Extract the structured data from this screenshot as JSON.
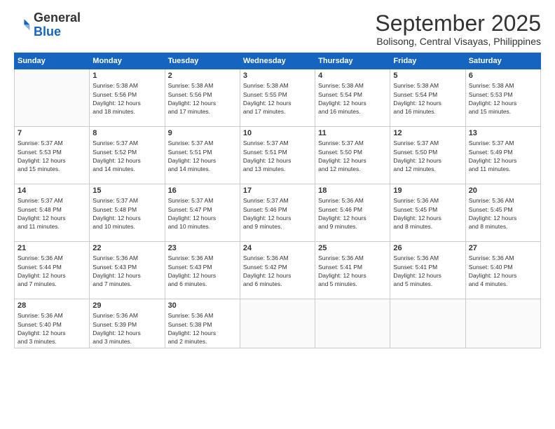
{
  "header": {
    "logo_general": "General",
    "logo_blue": "Blue",
    "month_title": "September 2025",
    "location": "Bolisong, Central Visayas, Philippines"
  },
  "weekdays": [
    "Sunday",
    "Monday",
    "Tuesday",
    "Wednesday",
    "Thursday",
    "Friday",
    "Saturday"
  ],
  "weeks": [
    [
      {
        "day": "",
        "info": ""
      },
      {
        "day": "1",
        "info": "Sunrise: 5:38 AM\nSunset: 5:56 PM\nDaylight: 12 hours\nand 18 minutes."
      },
      {
        "day": "2",
        "info": "Sunrise: 5:38 AM\nSunset: 5:56 PM\nDaylight: 12 hours\nand 17 minutes."
      },
      {
        "day": "3",
        "info": "Sunrise: 5:38 AM\nSunset: 5:55 PM\nDaylight: 12 hours\nand 17 minutes."
      },
      {
        "day": "4",
        "info": "Sunrise: 5:38 AM\nSunset: 5:54 PM\nDaylight: 12 hours\nand 16 minutes."
      },
      {
        "day": "5",
        "info": "Sunrise: 5:38 AM\nSunset: 5:54 PM\nDaylight: 12 hours\nand 16 minutes."
      },
      {
        "day": "6",
        "info": "Sunrise: 5:38 AM\nSunset: 5:53 PM\nDaylight: 12 hours\nand 15 minutes."
      }
    ],
    [
      {
        "day": "7",
        "info": "Sunrise: 5:37 AM\nSunset: 5:53 PM\nDaylight: 12 hours\nand 15 minutes."
      },
      {
        "day": "8",
        "info": "Sunrise: 5:37 AM\nSunset: 5:52 PM\nDaylight: 12 hours\nand 14 minutes."
      },
      {
        "day": "9",
        "info": "Sunrise: 5:37 AM\nSunset: 5:51 PM\nDaylight: 12 hours\nand 14 minutes."
      },
      {
        "day": "10",
        "info": "Sunrise: 5:37 AM\nSunset: 5:51 PM\nDaylight: 12 hours\nand 13 minutes."
      },
      {
        "day": "11",
        "info": "Sunrise: 5:37 AM\nSunset: 5:50 PM\nDaylight: 12 hours\nand 12 minutes."
      },
      {
        "day": "12",
        "info": "Sunrise: 5:37 AM\nSunset: 5:50 PM\nDaylight: 12 hours\nand 12 minutes."
      },
      {
        "day": "13",
        "info": "Sunrise: 5:37 AM\nSunset: 5:49 PM\nDaylight: 12 hours\nand 11 minutes."
      }
    ],
    [
      {
        "day": "14",
        "info": "Sunrise: 5:37 AM\nSunset: 5:48 PM\nDaylight: 12 hours\nand 11 minutes."
      },
      {
        "day": "15",
        "info": "Sunrise: 5:37 AM\nSunset: 5:48 PM\nDaylight: 12 hours\nand 10 minutes."
      },
      {
        "day": "16",
        "info": "Sunrise: 5:37 AM\nSunset: 5:47 PM\nDaylight: 12 hours\nand 10 minutes."
      },
      {
        "day": "17",
        "info": "Sunrise: 5:37 AM\nSunset: 5:46 PM\nDaylight: 12 hours\nand 9 minutes."
      },
      {
        "day": "18",
        "info": "Sunrise: 5:36 AM\nSunset: 5:46 PM\nDaylight: 12 hours\nand 9 minutes."
      },
      {
        "day": "19",
        "info": "Sunrise: 5:36 AM\nSunset: 5:45 PM\nDaylight: 12 hours\nand 8 minutes."
      },
      {
        "day": "20",
        "info": "Sunrise: 5:36 AM\nSunset: 5:45 PM\nDaylight: 12 hours\nand 8 minutes."
      }
    ],
    [
      {
        "day": "21",
        "info": "Sunrise: 5:36 AM\nSunset: 5:44 PM\nDaylight: 12 hours\nand 7 minutes."
      },
      {
        "day": "22",
        "info": "Sunrise: 5:36 AM\nSunset: 5:43 PM\nDaylight: 12 hours\nand 7 minutes."
      },
      {
        "day": "23",
        "info": "Sunrise: 5:36 AM\nSunset: 5:43 PM\nDaylight: 12 hours\nand 6 minutes."
      },
      {
        "day": "24",
        "info": "Sunrise: 5:36 AM\nSunset: 5:42 PM\nDaylight: 12 hours\nand 6 minutes."
      },
      {
        "day": "25",
        "info": "Sunrise: 5:36 AM\nSunset: 5:41 PM\nDaylight: 12 hours\nand 5 minutes."
      },
      {
        "day": "26",
        "info": "Sunrise: 5:36 AM\nSunset: 5:41 PM\nDaylight: 12 hours\nand 5 minutes."
      },
      {
        "day": "27",
        "info": "Sunrise: 5:36 AM\nSunset: 5:40 PM\nDaylight: 12 hours\nand 4 minutes."
      }
    ],
    [
      {
        "day": "28",
        "info": "Sunrise: 5:36 AM\nSunset: 5:40 PM\nDaylight: 12 hours\nand 3 minutes."
      },
      {
        "day": "29",
        "info": "Sunrise: 5:36 AM\nSunset: 5:39 PM\nDaylight: 12 hours\nand 3 minutes."
      },
      {
        "day": "30",
        "info": "Sunrise: 5:36 AM\nSunset: 5:38 PM\nDaylight: 12 hours\nand 2 minutes."
      },
      {
        "day": "",
        "info": ""
      },
      {
        "day": "",
        "info": ""
      },
      {
        "day": "",
        "info": ""
      },
      {
        "day": "",
        "info": ""
      }
    ]
  ]
}
